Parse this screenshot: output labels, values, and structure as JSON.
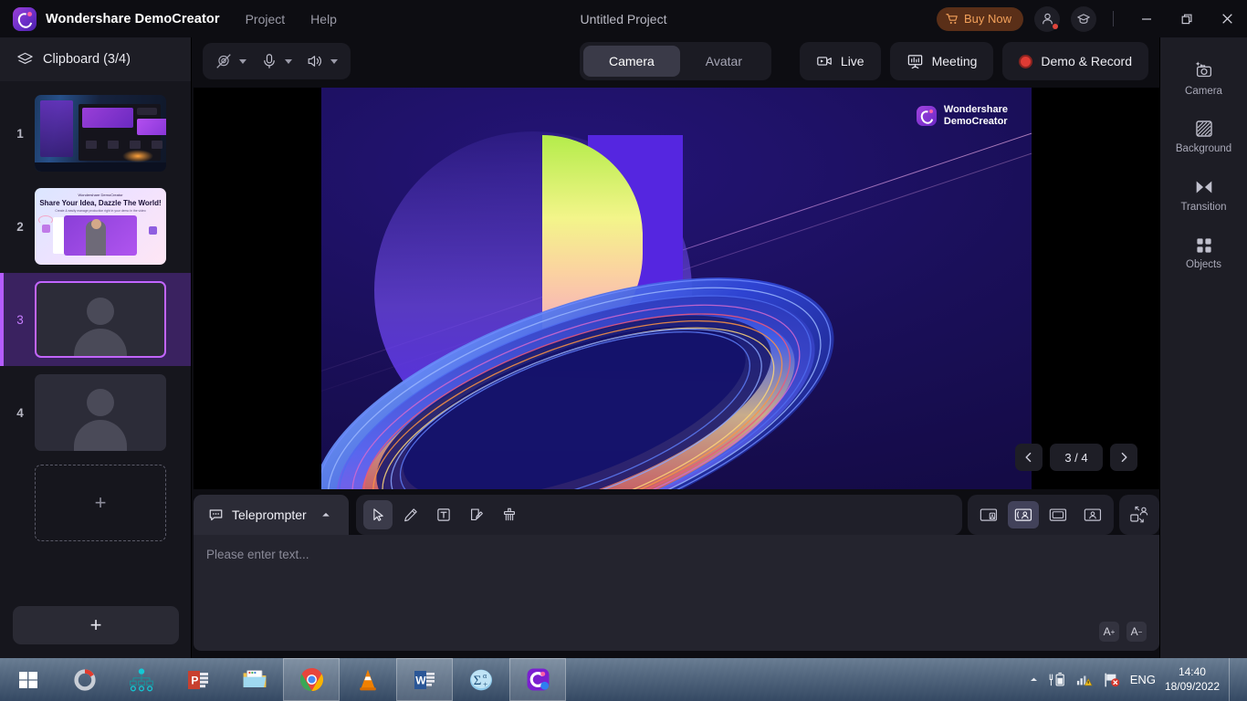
{
  "titlebar": {
    "brand": "Wondershare DemoCreator",
    "menus": [
      "Project",
      "Help"
    ],
    "project_title": "Untitled Project",
    "buy_label": "Buy Now",
    "buy_color": "#f2a05a",
    "icons": [
      "cart-icon",
      "account-icon",
      "graduation-cap-icon",
      "minimize-icon",
      "restore-icon",
      "close-icon"
    ]
  },
  "sidebar": {
    "header": "Clipboard (3/4)",
    "header_icon": "layers-icon",
    "items": [
      {
        "num": "1",
        "kind": "desktop-capture"
      },
      {
        "num": "2",
        "kind": "marketing-slide"
      },
      {
        "num": "3",
        "kind": "person-placeholder",
        "selected": true
      },
      {
        "num": "4",
        "kind": "person-placeholder",
        "selected": false
      }
    ],
    "add_slot_label": "+",
    "add_button_label": "+"
  },
  "toolbar": {
    "av": [
      {
        "icon": "camera-off-icon",
        "name": "camera-toggle"
      },
      {
        "icon": "microphone-icon",
        "name": "microphone-toggle"
      },
      {
        "icon": "speaker-icon",
        "name": "speaker-toggle"
      }
    ],
    "tabs": [
      {
        "label": "Camera",
        "active": true
      },
      {
        "label": "Avatar",
        "active": false
      }
    ],
    "actions": [
      {
        "label": "Live",
        "icon": "video-camera-icon"
      },
      {
        "label": "Meeting",
        "icon": "presentation-icon"
      },
      {
        "label": "Demo & Record",
        "icon": "record-dot-icon"
      }
    ]
  },
  "preview": {
    "watermark_line1": "Wondershare",
    "watermark_line2": "DemoCreator",
    "page_indicator": "3 / 4",
    "prev_icon": "chevron-left-icon",
    "next_icon": "chevron-right-icon",
    "bg_color": "#1c1060"
  },
  "right_panel": {
    "items": [
      {
        "label": "Camera",
        "icon": "camera-sparkle-icon"
      },
      {
        "label": "Background",
        "icon": "hatch-square-icon"
      },
      {
        "label": "Transition",
        "icon": "transition-icon"
      },
      {
        "label": "Objects",
        "icon": "grid-squares-icon"
      }
    ]
  },
  "teleprompter": {
    "tab_label": "Teleprompter",
    "tab_icon": "speech-bubble-icon",
    "collapse_icon": "caret-up-icon",
    "tools": [
      {
        "name": "select-tool",
        "icon": "cursor-arrow-icon",
        "active": true
      },
      {
        "name": "pencil-tool",
        "icon": "pencil-icon",
        "active": false
      },
      {
        "name": "text-tool",
        "icon": "text-box-icon",
        "active": false
      },
      {
        "name": "note-tool",
        "icon": "note-pencil-icon",
        "active": false
      },
      {
        "name": "eraser-tool",
        "icon": "brush-eraser-icon",
        "active": false
      }
    ],
    "views": [
      {
        "name": "screen-with-pip-left",
        "icon": "screen-pip-icon",
        "active": false
      },
      {
        "name": "screen-with-camera",
        "icon": "screen-camera-icon",
        "active": true
      },
      {
        "name": "screen-only",
        "icon": "screen-only-icon",
        "active": false
      },
      {
        "name": "camera-only",
        "icon": "person-frame-icon",
        "active": false
      }
    ],
    "pip_button": {
      "name": "swap-layout-button",
      "icon": "swap-pip-icon"
    },
    "placeholder": "Please enter text...",
    "font_increase": "A",
    "font_decrease": "A"
  },
  "taskbar": {
    "apps": [
      {
        "name": "start-button",
        "icon": "windows-logo-icon",
        "framed": false
      },
      {
        "name": "search-button",
        "icon": "search-circle-icon",
        "framed": false
      },
      {
        "name": "mindmap-app",
        "icon": "mindmap-icon",
        "framed": false
      },
      {
        "name": "powerpoint-app",
        "icon": "powerpoint-icon",
        "framed": false
      },
      {
        "name": "file-explorer-app",
        "icon": "folder-icon",
        "framed": false
      },
      {
        "name": "chrome-app",
        "icon": "chrome-icon",
        "framed": true
      },
      {
        "name": "vlc-app",
        "icon": "vlc-cone-icon",
        "framed": false
      },
      {
        "name": "word-app",
        "icon": "word-icon",
        "framed": true
      },
      {
        "name": "mathtype-app",
        "icon": "sigma-icon",
        "framed": false
      },
      {
        "name": "democreator-app",
        "icon": "democreator-icon",
        "framed": true
      }
    ],
    "tray": {
      "overflow_icon": "chevron-up-icon",
      "battery_icon": "battery-icon",
      "network_icon": "network-warning-icon",
      "flag_icon": "flag-error-icon",
      "language": "ENG",
      "time": "14:40",
      "date": "18/09/2022"
    }
  }
}
